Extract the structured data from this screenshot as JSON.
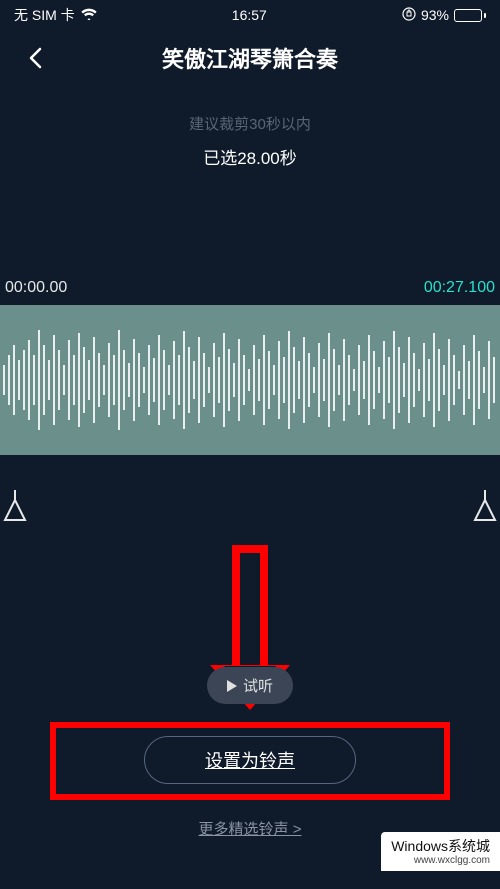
{
  "status": {
    "carrier": "无 SIM 卡",
    "time": "16:57",
    "battery_pct": "93%"
  },
  "nav": {
    "title": "笑傲江湖琴箫合奏"
  },
  "editor": {
    "trim_hint": "建议裁剪30秒以内",
    "selected_label": "已选28.00秒",
    "time_start": "00:00.00",
    "time_end": "00:27.100"
  },
  "actions": {
    "preview_label": "试听",
    "set_ringtone_label": "设置为铃声",
    "more_label": "更多精选铃声 >"
  },
  "watermark": {
    "title": "Windows系统城",
    "url": "www.wxclgg.com"
  }
}
